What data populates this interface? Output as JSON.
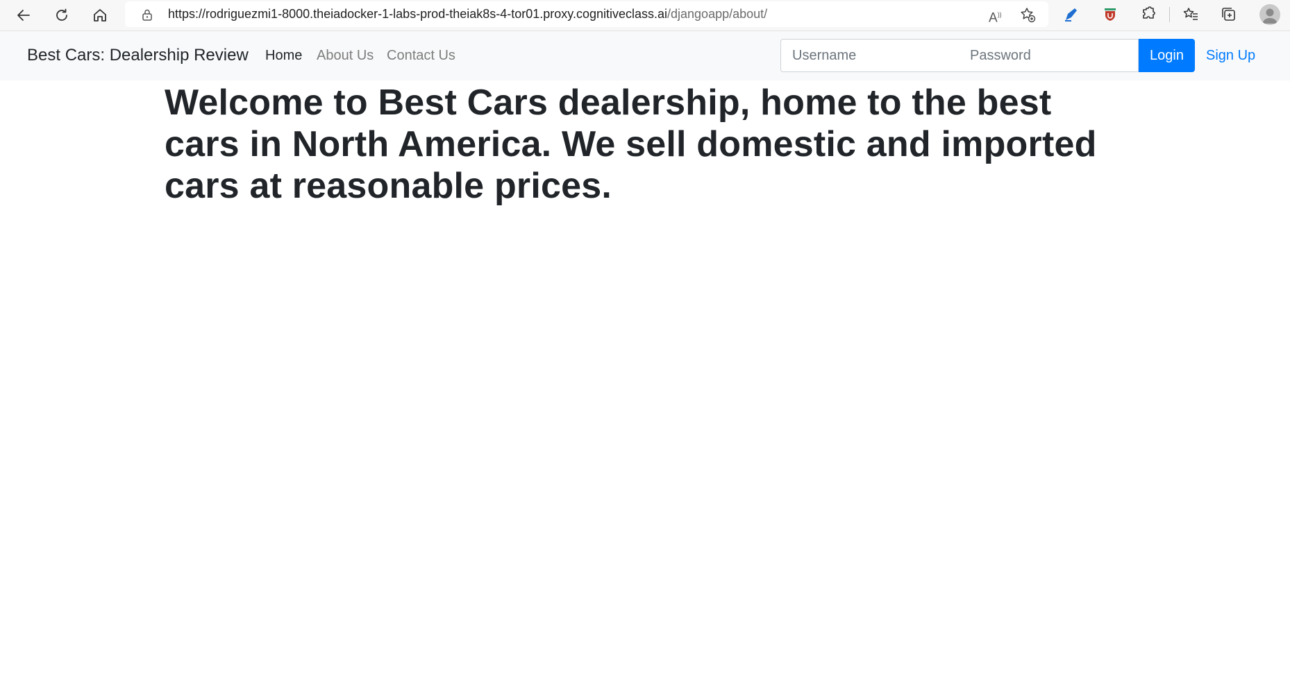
{
  "browser": {
    "url_host": "https://rodriguezmi1-8000.theiadocker-1-labs-prod-theiak8s-4-tor01.proxy.cognitiveclass.ai",
    "url_path": "/djangoapp/about/",
    "icons": [
      "back-icon",
      "refresh-icon",
      "home-icon",
      "lock-icon",
      "read-aloud-icon",
      "add-favorite-icon",
      "pen-extension-icon",
      "shield-extension-icon",
      "extensions-icon",
      "favorites-icon",
      "collections-icon",
      "profile-icon"
    ],
    "read_aloud_glyph": "A"
  },
  "navbar": {
    "brand": "Best Cars: Dealership Review",
    "links": [
      {
        "label": "Home",
        "active": true
      },
      {
        "label": "About Us",
        "active": false
      },
      {
        "label": "Contact Us",
        "active": false
      }
    ],
    "username_placeholder": "Username",
    "password_placeholder": "Password",
    "login_label": "Login",
    "signup_label": "Sign Up"
  },
  "colors": {
    "primary": "#007bff",
    "navbar_bg": "#f8f9fa",
    "text": "#212529"
  },
  "main": {
    "heading": "Welcome to Best Cars dealership, home to the best cars in North America. We sell domestic and imported cars at reasonable prices."
  }
}
